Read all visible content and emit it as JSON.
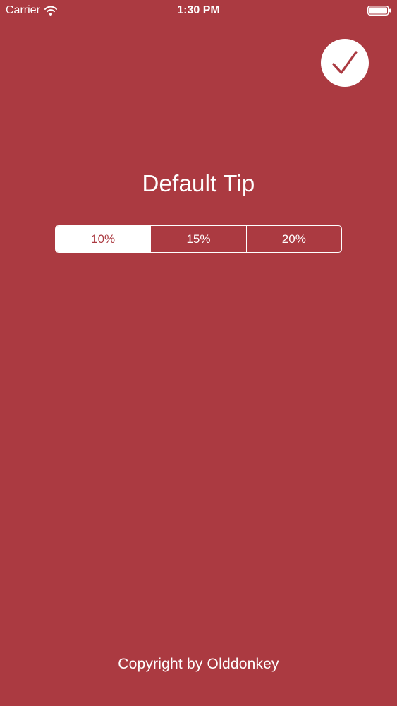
{
  "status_bar": {
    "carrier": "Carrier",
    "time": "1:30 PM",
    "icons": [
      "wifi-icon",
      "battery-icon"
    ]
  },
  "header": {
    "confirm_icon": "check-icon"
  },
  "settings": {
    "title": "Default Tip",
    "tip_options": [
      {
        "label": "10%",
        "selected": true
      },
      {
        "label": "15%",
        "selected": false
      },
      {
        "label": "20%",
        "selected": false
      }
    ]
  },
  "footer": {
    "copyright": "Copyright by Olddonkey"
  },
  "colors": {
    "background": "#ab3a41",
    "foreground": "#ffffff"
  }
}
